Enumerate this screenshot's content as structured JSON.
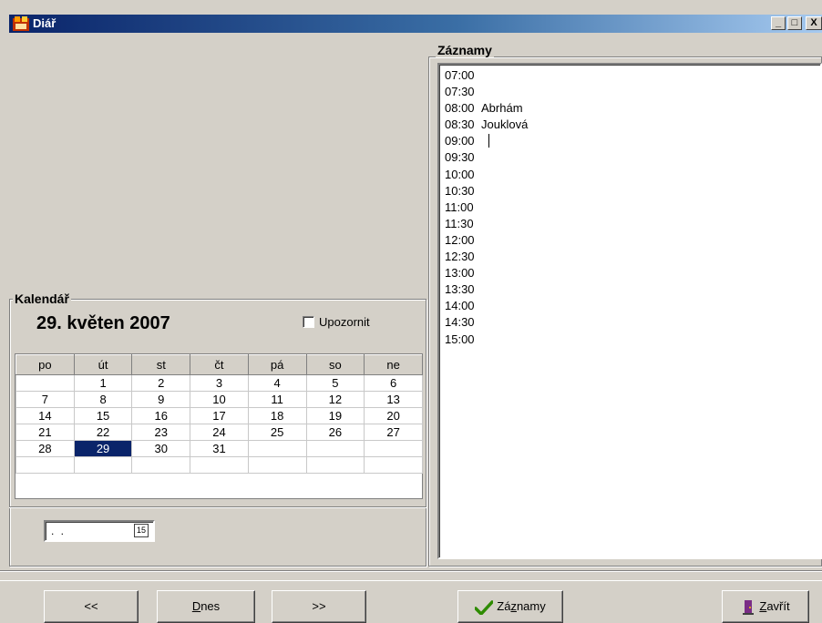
{
  "window": {
    "title": "Diář",
    "controls": {
      "minimize": "_",
      "maximize": "□",
      "close": "X"
    }
  },
  "records": {
    "caption": "Záznamy",
    "rows": [
      {
        "time": "07:00",
        "name": ""
      },
      {
        "time": "07:30",
        "name": ""
      },
      {
        "time": "08:00",
        "name": "Abrhám"
      },
      {
        "time": "08:30",
        "name": "Jouklová"
      },
      {
        "time": "09:00",
        "name": ""
      },
      {
        "time": "09:30",
        "name": ""
      },
      {
        "time": "10:00",
        "name": ""
      },
      {
        "time": "10:30",
        "name": ""
      },
      {
        "time": "11:00",
        "name": ""
      },
      {
        "time": "11:30",
        "name": ""
      },
      {
        "time": "12:00",
        "name": ""
      },
      {
        "time": "12:30",
        "name": ""
      },
      {
        "time": "13:00",
        "name": ""
      },
      {
        "time": "13:30",
        "name": ""
      },
      {
        "time": "14:00",
        "name": ""
      },
      {
        "time": "14:30",
        "name": ""
      },
      {
        "time": "15:00",
        "name": ""
      }
    ]
  },
  "calendar": {
    "caption": "Kalendář",
    "date_label": "29. květen 2007",
    "remind_label": "Upozornit",
    "remind_checked": false,
    "weekdays": [
      "po",
      "út",
      "st",
      "čt",
      "pá",
      "so",
      "ne"
    ],
    "weeks": [
      [
        "",
        "1",
        "2",
        "3",
        "4",
        "5",
        "6"
      ],
      [
        "7",
        "8",
        "9",
        "10",
        "11",
        "12",
        "13"
      ],
      [
        "14",
        "15",
        "16",
        "17",
        "18",
        "19",
        "20"
      ],
      [
        "21",
        "22",
        "23",
        "24",
        "25",
        "26",
        "27"
      ],
      [
        "28",
        "29",
        "30",
        "31",
        "",
        "",
        ""
      ],
      [
        "",
        "",
        "",
        "",
        "",
        "",
        ""
      ]
    ],
    "selected_day": "29",
    "date_input_value": ". .",
    "date_picker_icon": "calendar-icon",
    "date_picker_glyph": "15"
  },
  "buttons": {
    "prev": "<<",
    "today_mnemonic": "D",
    "today_rest": "nes",
    "next": ">>",
    "records_pre": "Zá",
    "records_mnemonic": "z",
    "records_post": "namy",
    "records_icon": "checkmark-icon",
    "close_mnemonic": "Z",
    "close_rest": "avřít",
    "close_icon": "exit-door-icon"
  },
  "colors": {
    "selection": "#0a246a",
    "face": "#d4d0c8",
    "check": "#2e8b00"
  }
}
